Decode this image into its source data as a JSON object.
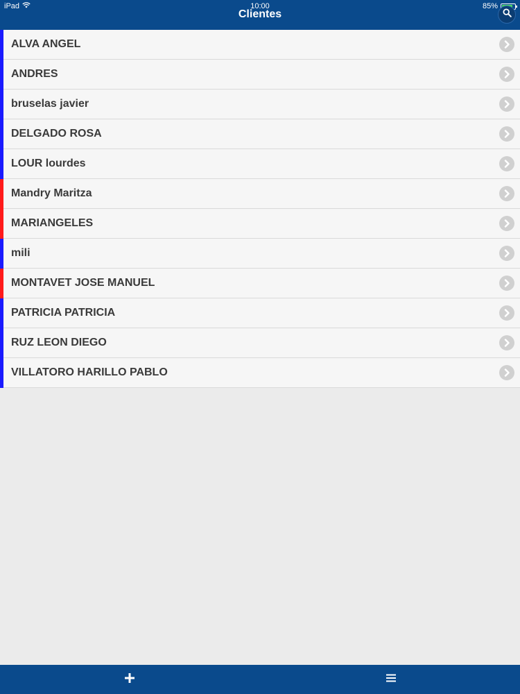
{
  "status_bar": {
    "device": "iPad",
    "time": "10:00",
    "battery": "85%",
    "battery_level": 0.85
  },
  "header": {
    "title": "Clientes",
    "search_icon": "search-icon"
  },
  "colors": {
    "header_bg": "#0a4a8c",
    "marker_blue": "#1a1aff",
    "marker_red": "#ff1a1a"
  },
  "clients": [
    {
      "name": "ALVA ANGEL",
      "marker": "blue"
    },
    {
      "name": "ANDRES",
      "marker": "blue"
    },
    {
      "name": "bruselas javier",
      "marker": "blue"
    },
    {
      "name": "DELGADO ROSA",
      "marker": "blue"
    },
    {
      "name": "LOUR lourdes",
      "marker": "blue"
    },
    {
      "name": "Mandry Maritza",
      "marker": "red"
    },
    {
      "name": "MARIANGELES",
      "marker": "red"
    },
    {
      "name": "mili",
      "marker": "blue"
    },
    {
      "name": "MONTAVET JOSE MANUEL",
      "marker": "red"
    },
    {
      "name": "PATRICIA PATRICIA",
      "marker": "blue"
    },
    {
      "name": "RUZ LEON DIEGO",
      "marker": "blue"
    },
    {
      "name": "VILLATORO HARILLO PABLO",
      "marker": "blue"
    }
  ],
  "footer": {
    "add_icon": "plus-icon",
    "menu_icon": "hamburger-menu-icon"
  }
}
